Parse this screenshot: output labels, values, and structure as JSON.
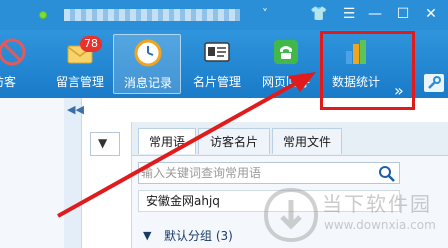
{
  "window": {
    "title": "",
    "chevron": "˅",
    "controls": {
      "skin": "👕",
      "menu": "☰",
      "minimize": "—",
      "maximize": "☐",
      "close": "✕"
    }
  },
  "toolbar": {
    "items": [
      {
        "id": "visitors",
        "label": "访客",
        "icon": "visitors-icon"
      },
      {
        "id": "messages",
        "label": "留言管理",
        "icon": "envelope-icon",
        "badge": "78"
      },
      {
        "id": "history",
        "label": "消息记录",
        "icon": "clock-icon",
        "active": true
      },
      {
        "id": "cards",
        "label": "名片管理",
        "icon": "id-card-icon"
      },
      {
        "id": "callback",
        "label": "网页回呼",
        "icon": "phone-icon"
      },
      {
        "id": "stats",
        "label": "数据统计",
        "icon": "bar-chart-icon",
        "highlighted": true
      }
    ],
    "more": "»"
  },
  "content": {
    "splitter_arrow": "◀◀",
    "dropdown_chevron": "▼",
    "tabs": [
      {
        "label": "常用语",
        "selected": true
      },
      {
        "label": "访客名片",
        "selected": false
      },
      {
        "label": "常用文件",
        "selected": false
      }
    ],
    "search_placeholder": "输入关键词查询常用语",
    "entry": "安徽金网ahjq",
    "group": {
      "caret": "▼",
      "label": "默认分组 (3)"
    }
  },
  "watermark": {
    "name": "当下软件园",
    "domain": "www.downxia.com"
  },
  "colors": {
    "titlebar": "#2a8fd6",
    "toolbar": "#1a7bc9",
    "highlight": "#e01b1b",
    "badge": "#e8322e"
  }
}
